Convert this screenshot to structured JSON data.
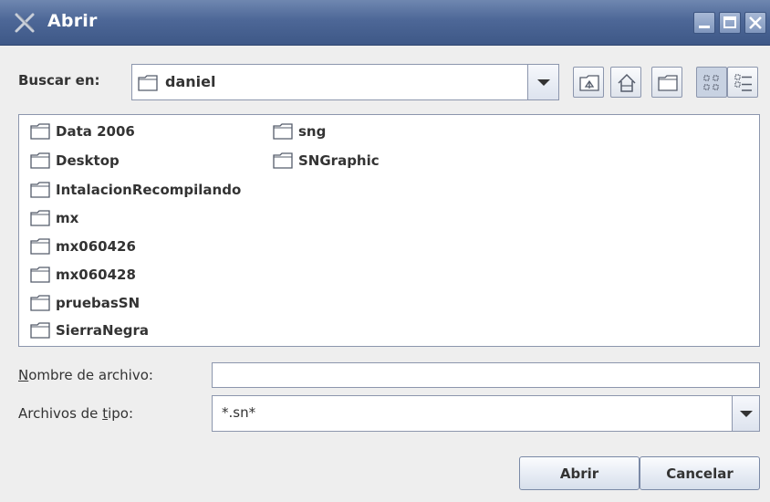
{
  "window": {
    "title": "Abrir"
  },
  "lookin": {
    "label": "Buscar en:",
    "value": "daniel"
  },
  "toolbar": {
    "up_icon": "up-folder-icon",
    "home_icon": "home-icon",
    "new_folder_icon": "new-folder-icon",
    "list_icon": "list-view-icon",
    "details_icon": "details-view-icon"
  },
  "files": [
    "Data 2006",
    "Desktop",
    "IntalacionRecompilando",
    "mx",
    "mx060426",
    "mx060428",
    "pruebasSN",
    "SierraNegra",
    "sng",
    "SNGraphic"
  ],
  "filename": {
    "label_underlined": "N",
    "label_rest": "ombre de archivo:",
    "value": ""
  },
  "filetype": {
    "label_before": "Archivos de ",
    "label_underlined": "t",
    "label_after": "ipo:",
    "value": "*.sn*"
  },
  "buttons": {
    "open": "Abrir",
    "cancel": "Cancelar"
  }
}
